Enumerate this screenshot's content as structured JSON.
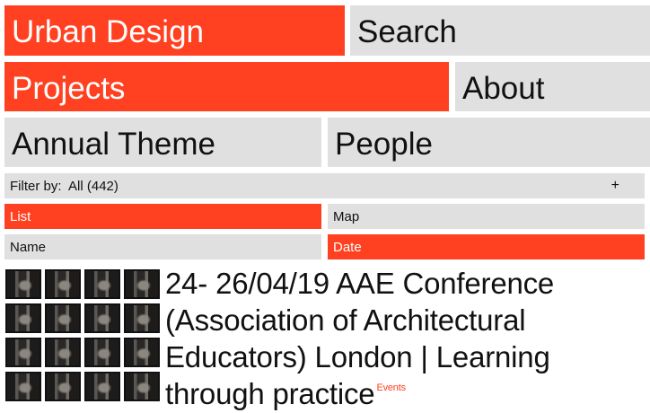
{
  "nav": {
    "site_title": "Urban Design",
    "search": "Search",
    "projects": "Projects",
    "about": "About",
    "annual_theme": "Annual Theme",
    "people": "People"
  },
  "filter": {
    "label": "Filter by:",
    "value": "All (442)",
    "toggle": "+"
  },
  "view": {
    "list": "List",
    "map": "Map",
    "active": "List"
  },
  "sort": {
    "name": "Name",
    "date": "Date",
    "active": "Date"
  },
  "project": {
    "title": "24- 26/04/19 AAE Conference (Association of Architectural Educators) London | Learning through practice",
    "tag": "Events",
    "thumbnail_count": 16
  },
  "colors": {
    "accent": "#ff4121",
    "inactive": "#e0e0e0"
  }
}
